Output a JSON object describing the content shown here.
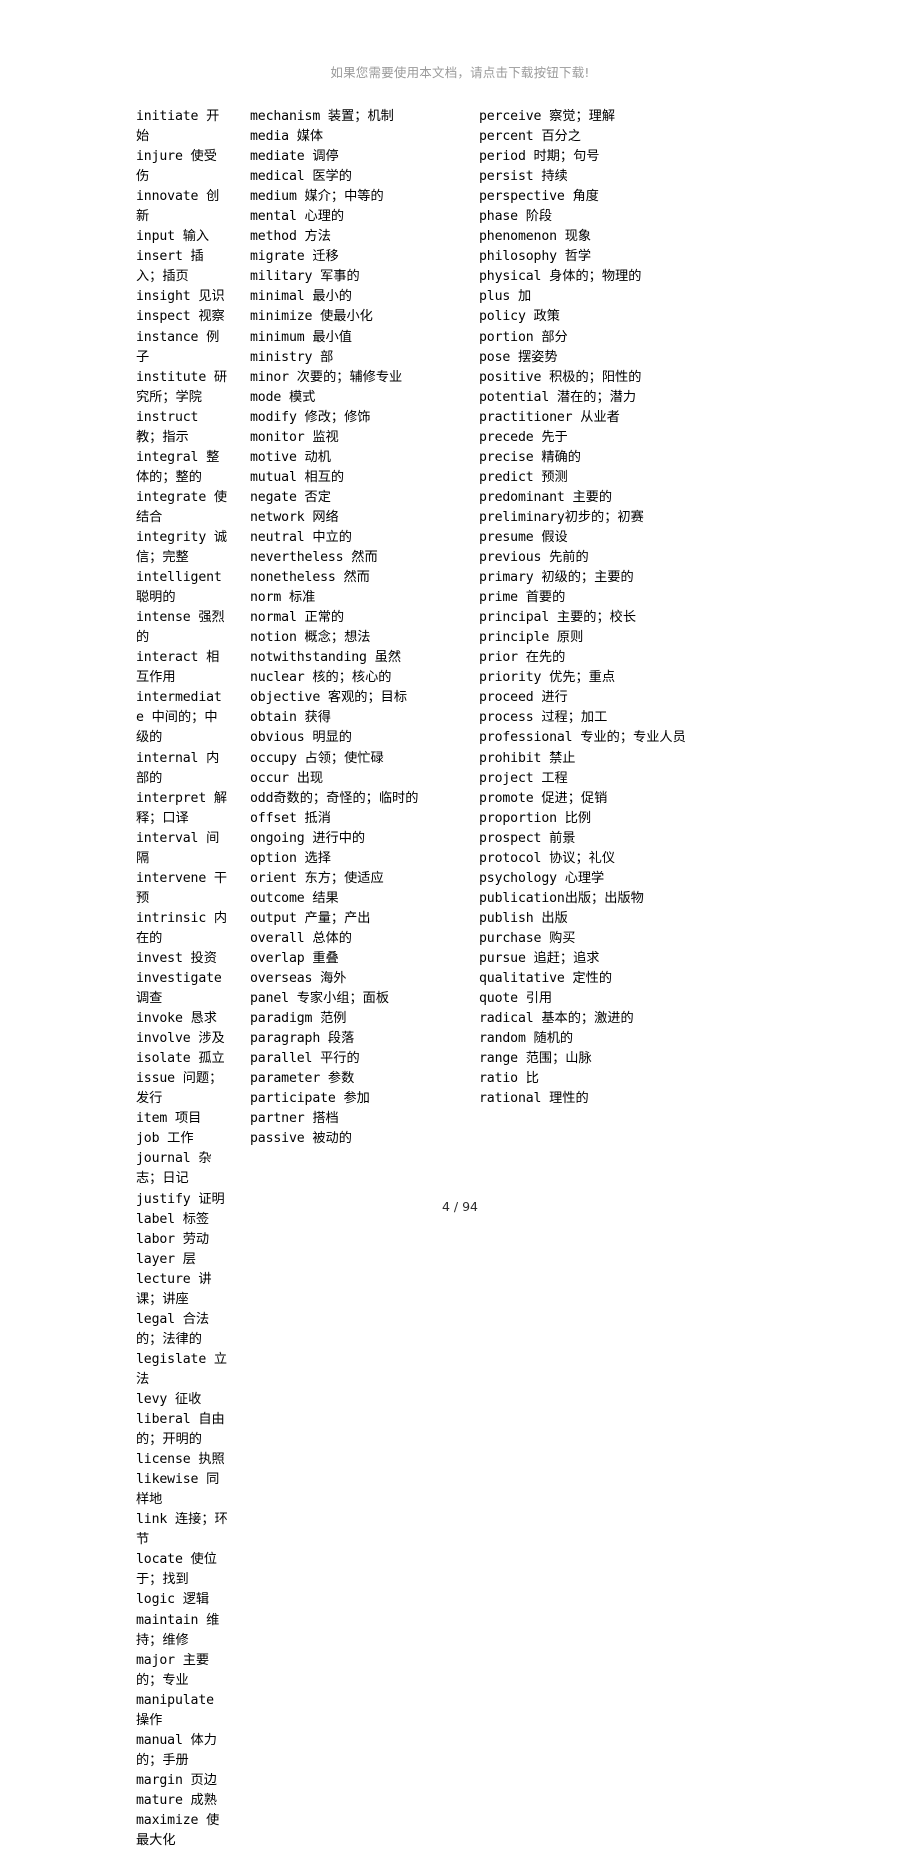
{
  "banner": {
    "text": "如果您需要使用本文档，请点击下载按钮下载!"
  },
  "footer": {
    "page_label": "4 / 94",
    "current_page": 4,
    "total_pages": 94
  },
  "columns": [
    {
      "id": "column-1",
      "entries": [
        "initiate 开始",
        "injure 使受伤",
        "innovate 创新",
        "input 输入",
        "insert 插入；插页",
        "insight 见识",
        "inspect 视察",
        "instance 例子",
        "institute 研究所；学院",
        "instruct 教；指示",
        "integral 整体的；整的",
        "integrate 使结合",
        "integrity 诚信；完整",
        "intelligent 聪明的",
        "intense 强烈的",
        "interact 相互作用",
        "intermediate 中间的；中级的",
        "internal 内部的",
        "interpret 解释；口译",
        "interval 间隔",
        "intervene 干预",
        "intrinsic 内在的",
        "invest 投资",
        "investigate 调查",
        "invoke 恳求",
        "involve 涉及",
        "isolate 孤立",
        "issue 问题；发行",
        "item 项目",
        "job 工作",
        "journal 杂志；日记",
        "justify 证明",
        "label 标签",
        "labor 劳动",
        "layer 层",
        "lecture 讲课；讲座",
        "legal 合法的；法律的",
        "legislate 立法",
        "levy 征收",
        "liberal 自由的；开明的",
        "license 执照",
        "likewise 同样地",
        "link 连接；环节",
        "locate 使位于；找到",
        "logic 逻辑",
        "maintain 维持；维修",
        "major 主要的；专业",
        "manipulate 操作",
        "manual 体力的；手册",
        "margin 页边",
        "mature 成熟",
        "maximize 使最大化"
      ]
    },
    {
      "id": "column-2",
      "entries": [
        "mechanism 装置；机制",
        "media 媒体",
        "mediate 调停",
        "medical 医学的",
        "medium 媒介；中等的",
        "mental 心理的",
        "method 方法",
        "migrate 迁移",
        "military 军事的",
        "minimal 最小的",
        "minimize 使最小化",
        "minimum 最小值",
        "ministry 部",
        "minor 次要的；辅修专业",
        "mode 模式",
        "modify 修改；修饰",
        "monitor 监视",
        "motive 动机",
        "mutual 相互的",
        "negate 否定",
        "network 网络",
        "neutral 中立的",
        "nevertheless 然而",
        "nonetheless 然而",
        "norm 标准",
        "normal 正常的",
        "notion 概念；想法",
        "notwithstanding 虽然",
        "nuclear 核的；核心的",
        "objective 客观的；目标",
        "obtain 获得",
        "obvious 明显的",
        "occupy 占领；使忙碌",
        "occur 出现",
        "odd奇数的；奇怪的；临时的",
        "offset 抵消",
        "ongoing 进行中的",
        "option 选择",
        "orient 东方；使适应",
        "outcome 结果",
        "output 产量；产出",
        "overall 总体的",
        "overlap 重叠",
        "overseas 海外",
        "panel 专家小组；面板",
        "paradigm 范例",
        "paragraph 段落",
        "parallel 平行的",
        "parameter 参数",
        "participate 参加",
        "partner 搭档",
        "passive 被动的"
      ]
    },
    {
      "id": "column-3",
      "entries": [
        "perceive 察觉；理解",
        "percent 百分之",
        "period 时期；句号",
        "persist 持续",
        "perspective 角度",
        "phase 阶段",
        "phenomenon 现象",
        "philosophy 哲学",
        "physical 身体的；物理的",
        "plus 加",
        "policy 政策",
        "portion 部分",
        "pose 摆姿势",
        "positive 积极的；阳性的",
        "potential 潜在的；潜力",
        "practitioner 从业者",
        "precede 先于",
        "precise 精确的",
        "predict 预测",
        "predominant 主要的",
        "preliminary初步的；初赛",
        "presume 假设",
        "previous 先前的",
        "primary 初级的；主要的",
        "prime 首要的",
        "principal 主要的；校长",
        "principle 原则",
        "prior 在先的",
        "priority 优先；重点",
        "proceed 进行",
        "process 过程；加工",
        "professional 专业的；专业人员",
        "prohibit 禁止",
        "project 工程",
        "promote 促进；促销",
        "proportion 比例",
        "prospect 前景",
        "protocol 协议；礼仪",
        "psychology 心理学",
        "publication出版；出版物",
        "publish 出版",
        "purchase 购买",
        "pursue 追赶；追求",
        "qualitative 定性的",
        "quote 引用",
        "radical 基本的；激进的",
        "random 随机的",
        "range 范围；山脉",
        "ratio 比",
        "rational 理性的"
      ]
    }
  ]
}
